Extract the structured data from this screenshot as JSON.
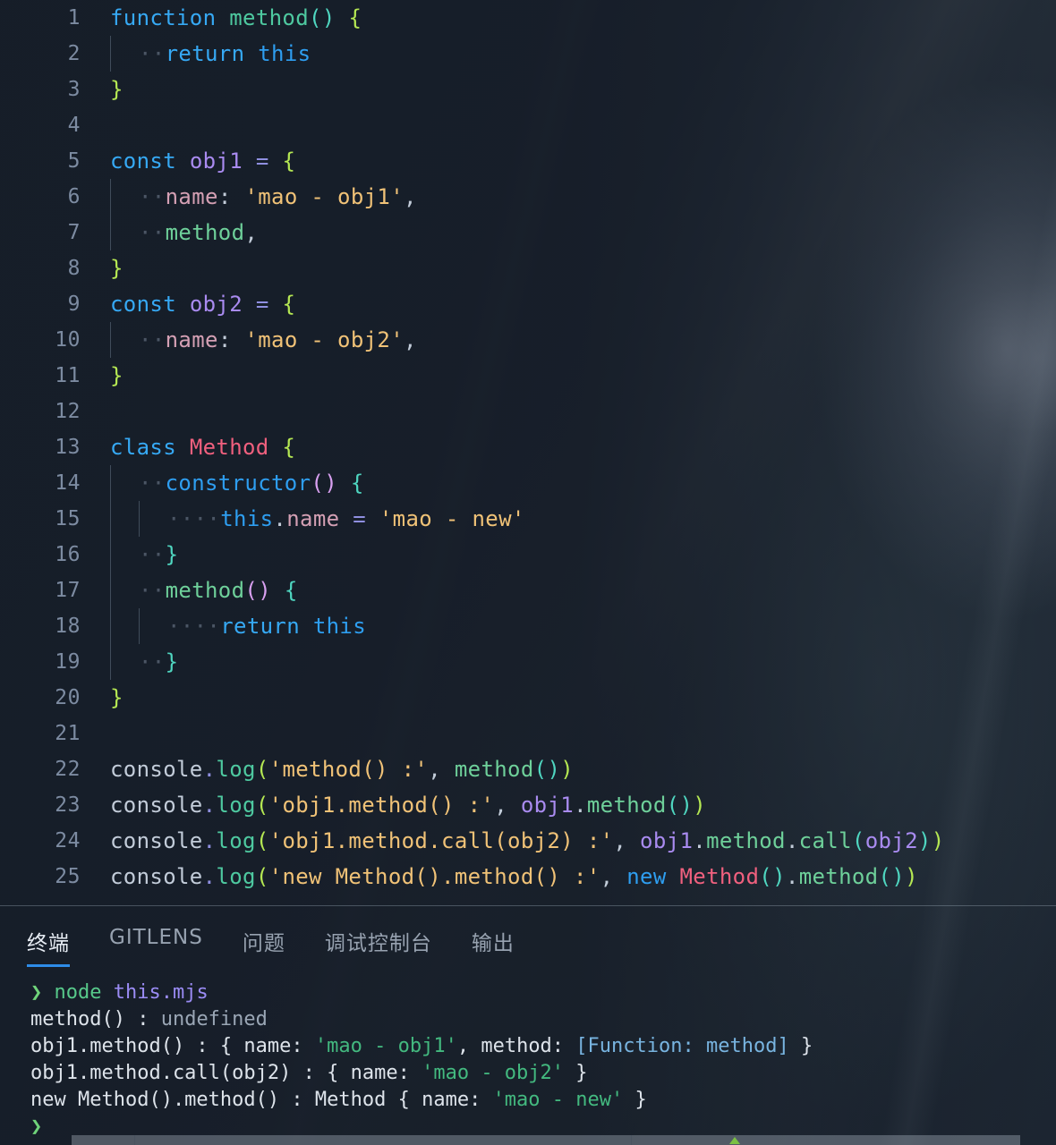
{
  "editor": {
    "language": "javascript",
    "first_line": 1,
    "lines": [
      {
        "n": "1",
        "indent": 0,
        "tokens": [
          {
            "t": "function",
            "c": "kw"
          },
          {
            "t": " ",
            "c": "plain"
          },
          {
            "t": "method",
            "c": "fn"
          },
          {
            "t": "()",
            "c": "p1"
          },
          {
            "t": " ",
            "c": "plain"
          },
          {
            "t": "{",
            "c": "p2"
          }
        ]
      },
      {
        "n": "2",
        "indent": 1,
        "tokens": [
          {
            "t": "return",
            "c": "kw"
          },
          {
            "t": " ",
            "c": "plain"
          },
          {
            "t": "this",
            "c": "kw2"
          }
        ]
      },
      {
        "n": "3",
        "indent": 0,
        "tokens": [
          {
            "t": "}",
            "c": "p2"
          }
        ]
      },
      {
        "n": "4",
        "indent": 0,
        "tokens": []
      },
      {
        "n": "5",
        "indent": 0,
        "tokens": [
          {
            "t": "const",
            "c": "kw"
          },
          {
            "t": " ",
            "c": "plain"
          },
          {
            "t": "obj1",
            "c": "var"
          },
          {
            "t": " ",
            "c": "plain"
          },
          {
            "t": "=",
            "c": "op"
          },
          {
            "t": " ",
            "c": "plain"
          },
          {
            "t": "{",
            "c": "p2"
          }
        ]
      },
      {
        "n": "6",
        "indent": 1,
        "tokens": [
          {
            "t": "name",
            "c": "prop"
          },
          {
            "t": ":",
            "c": "punct"
          },
          {
            "t": " ",
            "c": "plain"
          },
          {
            "t": "'mao - obj1'",
            "c": "str"
          },
          {
            "t": ",",
            "c": "punct"
          }
        ]
      },
      {
        "n": "7",
        "indent": 1,
        "tokens": [
          {
            "t": "method",
            "c": "fnlight"
          },
          {
            "t": ",",
            "c": "punct"
          }
        ]
      },
      {
        "n": "8",
        "indent": 0,
        "tokens": [
          {
            "t": "}",
            "c": "p2"
          }
        ]
      },
      {
        "n": "9",
        "indent": 0,
        "tokens": [
          {
            "t": "const",
            "c": "kw"
          },
          {
            "t": " ",
            "c": "plain"
          },
          {
            "t": "obj2",
            "c": "var"
          },
          {
            "t": " ",
            "c": "plain"
          },
          {
            "t": "=",
            "c": "op"
          },
          {
            "t": " ",
            "c": "plain"
          },
          {
            "t": "{",
            "c": "p2"
          }
        ]
      },
      {
        "n": "10",
        "indent": 1,
        "tokens": [
          {
            "t": "name",
            "c": "prop"
          },
          {
            "t": ":",
            "c": "punct"
          },
          {
            "t": " ",
            "c": "plain"
          },
          {
            "t": "'mao - obj2'",
            "c": "str"
          },
          {
            "t": ",",
            "c": "punct"
          }
        ]
      },
      {
        "n": "11",
        "indent": 0,
        "tokens": [
          {
            "t": "}",
            "c": "p2"
          }
        ]
      },
      {
        "n": "12",
        "indent": 0,
        "tokens": []
      },
      {
        "n": "13",
        "indent": 0,
        "tokens": [
          {
            "t": "class",
            "c": "kw"
          },
          {
            "t": " ",
            "c": "plain"
          },
          {
            "t": "Method",
            "c": "cls"
          },
          {
            "t": " ",
            "c": "plain"
          },
          {
            "t": "{",
            "c": "p2"
          }
        ]
      },
      {
        "n": "14",
        "indent": 1,
        "tokens": [
          {
            "t": "constructor",
            "c": "kw2"
          },
          {
            "t": "()",
            "c": "p3"
          },
          {
            "t": " ",
            "c": "plain"
          },
          {
            "t": "{",
            "c": "p1"
          }
        ]
      },
      {
        "n": "15",
        "indent": 2,
        "tokens": [
          {
            "t": "this",
            "c": "kw2"
          },
          {
            "t": ".",
            "c": "punct"
          },
          {
            "t": "name",
            "c": "prop"
          },
          {
            "t": " ",
            "c": "plain"
          },
          {
            "t": "=",
            "c": "op"
          },
          {
            "t": " ",
            "c": "plain"
          },
          {
            "t": "'mao - new'",
            "c": "str"
          }
        ]
      },
      {
        "n": "16",
        "indent": 1,
        "tokens": [
          {
            "t": "}",
            "c": "p1"
          }
        ]
      },
      {
        "n": "17",
        "indent": 1,
        "tokens": [
          {
            "t": "method",
            "c": "fnlight"
          },
          {
            "t": "()",
            "c": "p3"
          },
          {
            "t": " ",
            "c": "plain"
          },
          {
            "t": "{",
            "c": "p1"
          }
        ]
      },
      {
        "n": "18",
        "indent": 2,
        "tokens": [
          {
            "t": "return",
            "c": "kw"
          },
          {
            "t": " ",
            "c": "plain"
          },
          {
            "t": "this",
            "c": "kw2"
          }
        ]
      },
      {
        "n": "19",
        "indent": 1,
        "tokens": [
          {
            "t": "}",
            "c": "p1"
          }
        ]
      },
      {
        "n": "20",
        "indent": 0,
        "tokens": [
          {
            "t": "}",
            "c": "p2"
          }
        ]
      },
      {
        "n": "21",
        "indent": 0,
        "tokens": []
      },
      {
        "n": "22",
        "indent": 0,
        "tokens": [
          {
            "t": "console",
            "c": "plain"
          },
          {
            "t": ".",
            "c": "op"
          },
          {
            "t": "log",
            "c": "fn"
          },
          {
            "t": "(",
            "c": "p2"
          },
          {
            "t": "'method() :'",
            "c": "str"
          },
          {
            "t": ",",
            "c": "punct"
          },
          {
            "t": " ",
            "c": "plain"
          },
          {
            "t": "method",
            "c": "fnlight"
          },
          {
            "t": "()",
            "c": "p1"
          },
          {
            "t": ")",
            "c": "p2"
          }
        ]
      },
      {
        "n": "23",
        "indent": 0,
        "tokens": [
          {
            "t": "console",
            "c": "plain"
          },
          {
            "t": ".",
            "c": "op"
          },
          {
            "t": "log",
            "c": "fn"
          },
          {
            "t": "(",
            "c": "p2"
          },
          {
            "t": "'obj1.method() :'",
            "c": "str"
          },
          {
            "t": ",",
            "c": "punct"
          },
          {
            "t": " ",
            "c": "plain"
          },
          {
            "t": "obj1",
            "c": "var"
          },
          {
            "t": ".",
            "c": "punct"
          },
          {
            "t": "method",
            "c": "fnlight"
          },
          {
            "t": "()",
            "c": "p1"
          },
          {
            "t": ")",
            "c": "p2"
          }
        ]
      },
      {
        "n": "24",
        "indent": 0,
        "tokens": [
          {
            "t": "console",
            "c": "plain"
          },
          {
            "t": ".",
            "c": "op"
          },
          {
            "t": "log",
            "c": "fn"
          },
          {
            "t": "(",
            "c": "p2"
          },
          {
            "t": "'obj1.method.call(obj2) :'",
            "c": "str"
          },
          {
            "t": ",",
            "c": "punct"
          },
          {
            "t": " ",
            "c": "plain"
          },
          {
            "t": "obj1",
            "c": "var"
          },
          {
            "t": ".",
            "c": "punct"
          },
          {
            "t": "method",
            "c": "fnlight"
          },
          {
            "t": ".",
            "c": "punct"
          },
          {
            "t": "call",
            "c": "fnlight"
          },
          {
            "t": "(",
            "c": "p1"
          },
          {
            "t": "obj2",
            "c": "var"
          },
          {
            "t": ")",
            "c": "p1"
          },
          {
            "t": ")",
            "c": "p2"
          }
        ]
      },
      {
        "n": "25",
        "indent": 0,
        "tokens": [
          {
            "t": "console",
            "c": "plain"
          },
          {
            "t": ".",
            "c": "op"
          },
          {
            "t": "log",
            "c": "fn"
          },
          {
            "t": "(",
            "c": "p2"
          },
          {
            "t": "'new Method().method() :'",
            "c": "str"
          },
          {
            "t": ",",
            "c": "punct"
          },
          {
            "t": " ",
            "c": "plain"
          },
          {
            "t": "new",
            "c": "kw2"
          },
          {
            "t": " ",
            "c": "plain"
          },
          {
            "t": "Method",
            "c": "cls"
          },
          {
            "t": "()",
            "c": "p1"
          },
          {
            "t": ".",
            "c": "punct"
          },
          {
            "t": "method",
            "c": "fnlight"
          },
          {
            "t": "()",
            "c": "p1"
          },
          {
            "t": ")",
            "c": "p2"
          }
        ]
      }
    ]
  },
  "panel": {
    "tabs": [
      {
        "label": "终端",
        "active": true
      },
      {
        "label": "GITLENS",
        "active": false
      },
      {
        "label": "问题",
        "active": false
      },
      {
        "label": "调试控制台",
        "active": false
      },
      {
        "label": "输出",
        "active": false
      }
    ],
    "active_tab_accent": "#2e8ce8"
  },
  "terminal": {
    "lines": [
      {
        "segs": [
          {
            "t": "❯",
            "c": "t-prompt"
          },
          {
            "t": " ",
            "c": "t-plain"
          },
          {
            "t": "node",
            "c": "t-cmd"
          },
          {
            "t": " ",
            "c": "t-plain"
          },
          {
            "t": "this.mjs",
            "c": "t-arg"
          }
        ]
      },
      {
        "segs": [
          {
            "t": "method() : ",
            "c": "t-plain"
          },
          {
            "t": "undefined",
            "c": "t-dim"
          }
        ]
      },
      {
        "segs": [
          {
            "t": "obj1.method() : { name: ",
            "c": "t-plain"
          },
          {
            "t": "'mao - obj1'",
            "c": "t-str"
          },
          {
            "t": ", method: ",
            "c": "t-plain"
          },
          {
            "t": "[Function: method]",
            "c": "t-fn"
          },
          {
            "t": " }",
            "c": "t-plain"
          }
        ]
      },
      {
        "segs": [
          {
            "t": "obj1.method.call(obj2) : { name: ",
            "c": "t-plain"
          },
          {
            "t": "'mao - obj2'",
            "c": "t-str"
          },
          {
            "t": " }",
            "c": "t-plain"
          }
        ]
      },
      {
        "segs": [
          {
            "t": "new Method().method() : Method { name: ",
            "c": "t-plain"
          },
          {
            "t": "'mao - new'",
            "c": "t-str"
          },
          {
            "t": " }",
            "c": "t-plain"
          }
        ]
      },
      {
        "segs": [
          {
            "t": "❯",
            "c": "t-prompt"
          }
        ]
      }
    ]
  }
}
